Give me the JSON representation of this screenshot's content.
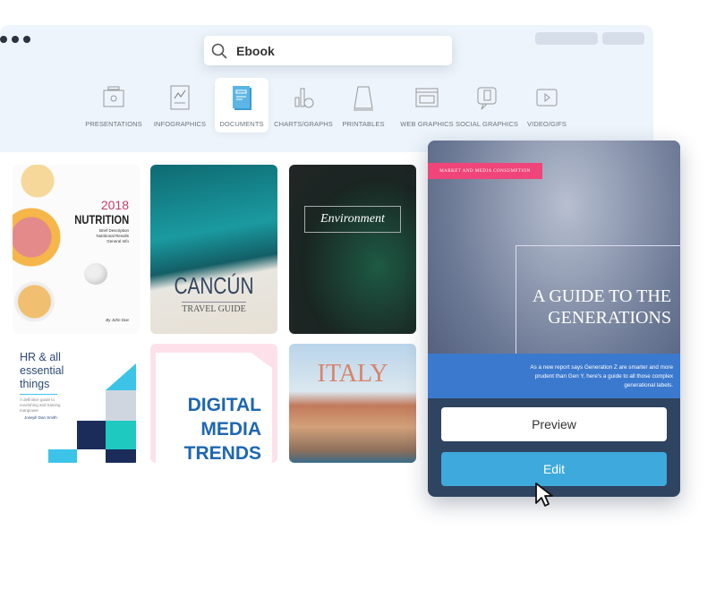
{
  "search": {
    "value": "Ebook",
    "placeholder": ""
  },
  "categories": [
    {
      "label": "PRESENTATIONS",
      "icon": "presentation-icon"
    },
    {
      "label": "INFOGRAPHICS",
      "icon": "infographic-icon"
    },
    {
      "label": "DOCUMENTS",
      "icon": "document-icon",
      "selected": true
    },
    {
      "label": "CHARTS/GRAPHS",
      "icon": "chart-icon"
    },
    {
      "label": "PRINTABLES",
      "icon": "printable-icon"
    },
    {
      "label": "WEB GRAPHICS",
      "icon": "web-graphic-icon"
    },
    {
      "label": "SOCIAL GRAPHICS",
      "icon": "social-graphic-icon"
    },
    {
      "label": "VIDEO/GIFS",
      "icon": "video-icon"
    }
  ],
  "templates": [
    {
      "year": "2018",
      "title": "NUTRITION",
      "lines": [
        "Brief Description",
        "Nutritional Results",
        "General Info"
      ],
      "author": "By John Doe"
    },
    {
      "title": "CANCÚN",
      "subtitle": "TRAVEL GUIDE"
    },
    {
      "title": "Environment"
    },
    {
      "title": "HR & all essential things",
      "subtitle": "A definitive guide to nourishing and training manpower",
      "author": "Joseph Dan Smith"
    },
    {
      "title": "DIGITAL MEDIA TRENDS"
    },
    {
      "title": "ITALY"
    }
  ],
  "preview_card": {
    "tag": "MARKET AND MEDIA CONSUMPTION",
    "title": "A GUIDE TO THE GENERATIONS",
    "body": "As a new report says Generation Z are smarter and more prudent than Gen Y, here's a guide to all those complex generational labels.",
    "preview_label": "Preview",
    "edit_label": "Edit"
  },
  "colors": {
    "accent": "#3ea9dc",
    "pink": "#f0457a",
    "window": "#edf4fb"
  }
}
